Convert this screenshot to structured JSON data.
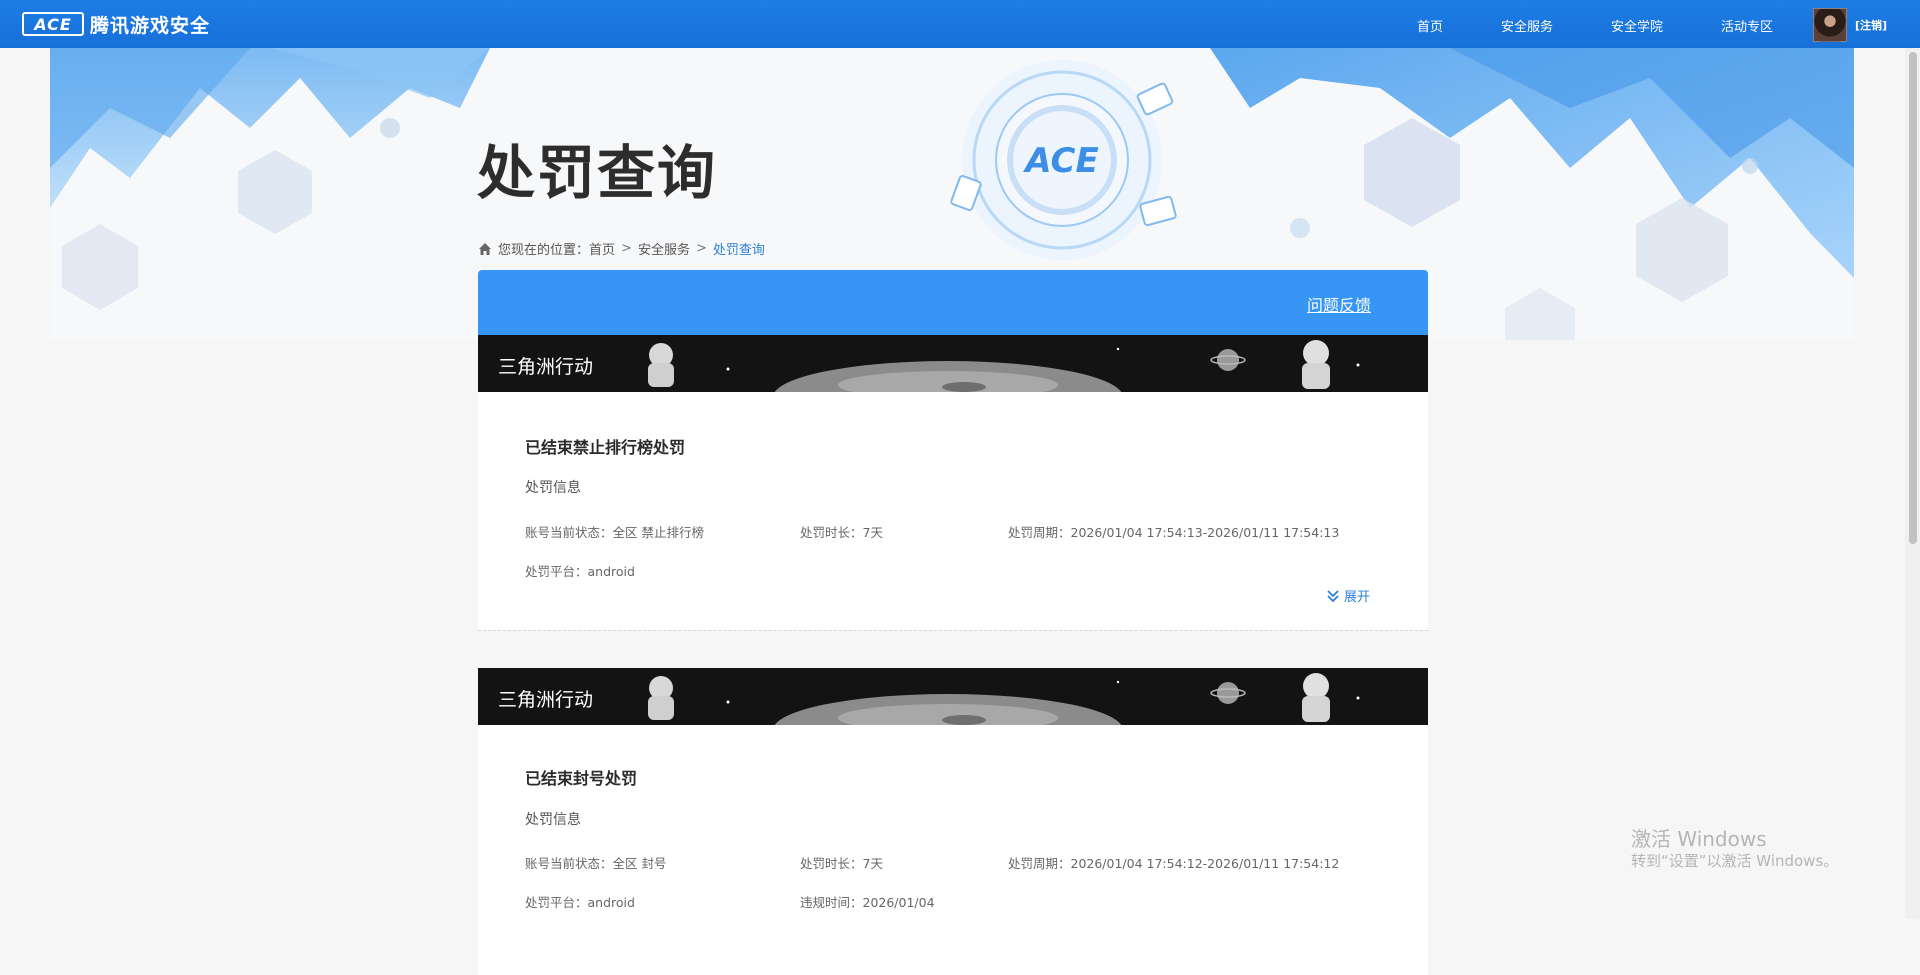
{
  "header": {
    "logo_mark": "ACE",
    "logo_text": "腾讯游戏安全",
    "nav": [
      "首页",
      "安全服务",
      "安全学院",
      "活动专区"
    ],
    "logout": "[注销]"
  },
  "page": {
    "title": "处罚查询",
    "breadcrumb": {
      "prefix": "您现在的位置：",
      "items": [
        "首页",
        "安全服务",
        "处罚查询"
      ],
      "separator": ">"
    },
    "feedback_label": "问题反馈"
  },
  "records": [
    {
      "game": "三角洲行动",
      "title": "已结束禁止排行榜处罚",
      "section": "处罚信息",
      "status": "账号当前状态：全区 禁止排行榜",
      "duration": "处罚时长：7天",
      "period": "处罚周期：2026/01/04 17:54:13-2026/01/11 17:54:13",
      "platform": "处罚平台：android",
      "expand_label": "展开"
    },
    {
      "game": "三角洲行动",
      "title": "已结束封号处罚",
      "section": "处罚信息",
      "status": "账号当前状态：全区 封号",
      "duration": "处罚时长：7天",
      "period": "处罚周期：2026/01/04 17:54:12-2026/01/11 17:54:12",
      "platform": "处罚平台：android",
      "violation_time": "违规时间：2026/01/04"
    }
  ],
  "watermark": {
    "line1": "激活 Windows",
    "line2": "转到“设置”以激活 Windows。"
  },
  "colors": {
    "topbar": "#1670d8",
    "panel_header": "#3795f5",
    "link": "#2b7fd8"
  }
}
